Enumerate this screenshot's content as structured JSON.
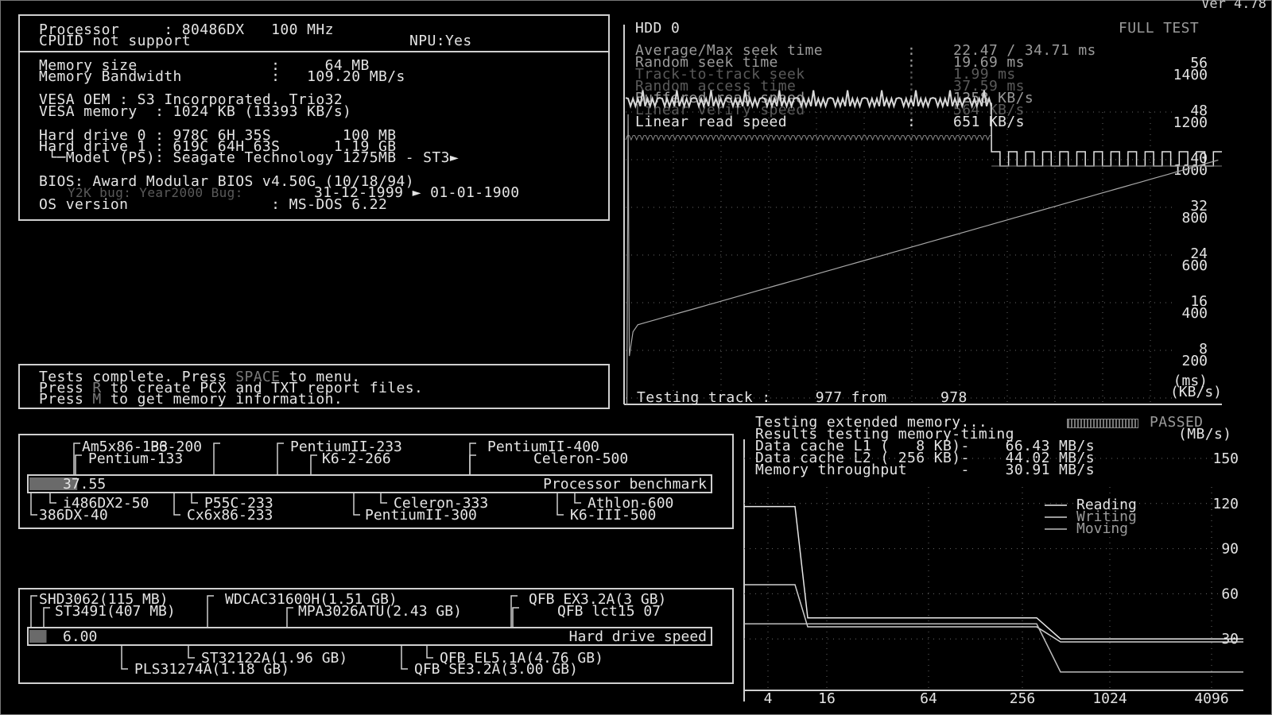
{
  "version": "Ver 4.78",
  "sysinfo": {
    "processor": "Processor     : 80486DX   100 MHz",
    "cpuid": "CPUID not support",
    "npu": "NPU:Yes",
    "mem_size": "Memory size               :     64 MB",
    "mem_bw": "Memory Bandwidth          :   109.20 MB/s",
    "vesa_oem": "VESA OEM : S3 Incorporated. Trio32",
    "vesa_mem": "VESA memory  : 1024 KB (13393 KB/s)",
    "hd0": "Hard drive 0 : 978C 6H 35S        100 MB",
    "hd1": "Hard drive 1 : 619C 64H 63S      1.19 GB",
    "hd_model": " └─Model (PS): Seagate Technology 1275MB - ST3►",
    "bios": "BIOS: Award Modular BIOS v4.50G (10/18/94)",
    "y2k_label": "Y2K bug: Year2000 Bug:",
    "y2k_value": "31-12-1999 ► 01-01-1900",
    "os": "OS version                : MS-DOS 6.22"
  },
  "messages": {
    "l1a": "Tests complete. Press ",
    "l1k": "SPACE",
    "l1b": " to menu.",
    "l2a": "Press ",
    "l2k": "R",
    "l2b": " to create PCX and TXT report files.",
    "l3a": "Press ",
    "l3k": "M",
    "l3b": " to get memory information."
  },
  "hdd": {
    "title": "HDD 0",
    "mode": "FULL TEST",
    "rows": [
      {
        "label": "Average/Max seek time",
        "value": "22.47 / 34.71 ms",
        "style": "mid"
      },
      {
        "label": "Random seek time",
        "value": "19.69 ms",
        "style": "mid"
      },
      {
        "label": "Track-to-track seek",
        "value": "1.99 ms",
        "style": "dim"
      },
      {
        "label": "Random access time",
        "value": "37.59 ms",
        "style": "dim"
      },
      {
        "label": "Buffered read speed",
        "value": "1258 KB/s",
        "style": "mid"
      },
      {
        "label": "Linear verify speed",
        "value": "564 KB/s",
        "style": "dim"
      },
      {
        "label": "Linear read speed",
        "value": "651 KB/s",
        "style": "main"
      }
    ],
    "ms_ticks": [
      "56",
      "48",
      "40",
      "32",
      "24",
      "16",
      "8"
    ],
    "kb_ticks": [
      "1400",
      "1200",
      "1000",
      "800",
      "600",
      "400",
      "200"
    ],
    "unit_ms": "(ms)",
    "unit_kb": "(KB/s)",
    "status": "Testing track :     977 from      978"
  },
  "cpu_bench": {
    "value": "37.55",
    "fill_fraction": 0.07,
    "label": "Processor benchmark",
    "top_refs": [
      "Am5x86-133",
      "Pentium-133",
      "P6-200",
      "PentiumII-233",
      "K6-2-266",
      "PentiumII-400",
      "Celeron-500"
    ],
    "bottom_refs": [
      "i486DX2-50",
      "386DX-40",
      "P55C-233",
      "Cx6x86-233",
      "Celeron-333",
      "PentiumII-300",
      "Athlon-600",
      "K6-III-500"
    ]
  },
  "hd_bench": {
    "value": "6.00",
    "fill_fraction": 0.025,
    "label": "Hard drive speed",
    "top_refs": [
      "SHD3062(115 MB)",
      "ST3491(407 MB)",
      "WDCAC31600H(1.51 GB)",
      "MPA3026ATU(2.43 GB)",
      "QFB EX3.2A(3 GB)",
      "QFB lct15 07"
    ],
    "bottom_refs": [
      "ST32122A(1.96 GB)",
      "PLS31274A(1.18 GB)",
      "QFB EL5.1A(4.76 GB)",
      "QFB SE3.2A(3.00 GB)"
    ]
  },
  "memtest": {
    "line1": "Testing extended memory...",
    "passed": "PASSED",
    "line2": "Results testing memory-timing",
    "unit": "(MB/s)",
    "l1": "Data cache L1 (   8 KB)-    66.43 MB/s",
    "l2": "Data cache L2 ( 256 KB)-    44.02 MB/s",
    "thr": "Memory throughput      -    30.91 MB/s",
    "legend": [
      "Reading",
      "Writing",
      "Moving"
    ],
    "y_ticks": [
      "150",
      "120",
      "90",
      "60",
      "30"
    ],
    "x_ticks": [
      "4",
      "16",
      "64",
      "256",
      "1024",
      "4096"
    ]
  },
  "colors": {
    "fg": "#e4e4e4",
    "dim": "#5a5a5a",
    "mid": "#9a9a9a",
    "grid": "#6a6a6a",
    "bg": "#000000"
  },
  "chart_data": [
    {
      "type": "line",
      "title": "HDD 0",
      "xlabel": "",
      "ylabel": "(KB/s)",
      "ylim": [
        0,
        1400
      ],
      "series": [
        {
          "name": "Linear read speed",
          "x": [
            0,
            40,
            80,
            120,
            160,
            200,
            240,
            280,
            320,
            360,
            400,
            440,
            480,
            520,
            560,
            600,
            640,
            680,
            720,
            760,
            800,
            840,
            880,
            920,
            960,
            978
          ],
          "values": [
            1280,
            1265,
            1265,
            1265,
            1265,
            1265,
            1265,
            1265,
            1265,
            1265,
            1265,
            1265,
            1265,
            1265,
            1265,
            1265,
            1265,
            1265,
            1265,
            1265,
            1265,
            1265,
            1265,
            1265,
            1265,
            1265
          ]
        }
      ]
    },
    {
      "type": "line",
      "title": "",
      "xlabel": "",
      "ylabel": "(MB/s)",
      "ylim": [
        0,
        165
      ],
      "categories": [
        "4",
        "16",
        "64",
        "256",
        "1024",
        "4096"
      ],
      "series": [
        {
          "name": "Reading",
          "values": [
            118,
            118,
            44,
            44,
            30,
            30
          ]
        },
        {
          "name": "Writing",
          "values": [
            66,
            66,
            38,
            38,
            28,
            28
          ]
        },
        {
          "name": "Moving",
          "values": [
            40,
            40,
            40,
            40,
            8,
            8
          ]
        }
      ]
    }
  ]
}
